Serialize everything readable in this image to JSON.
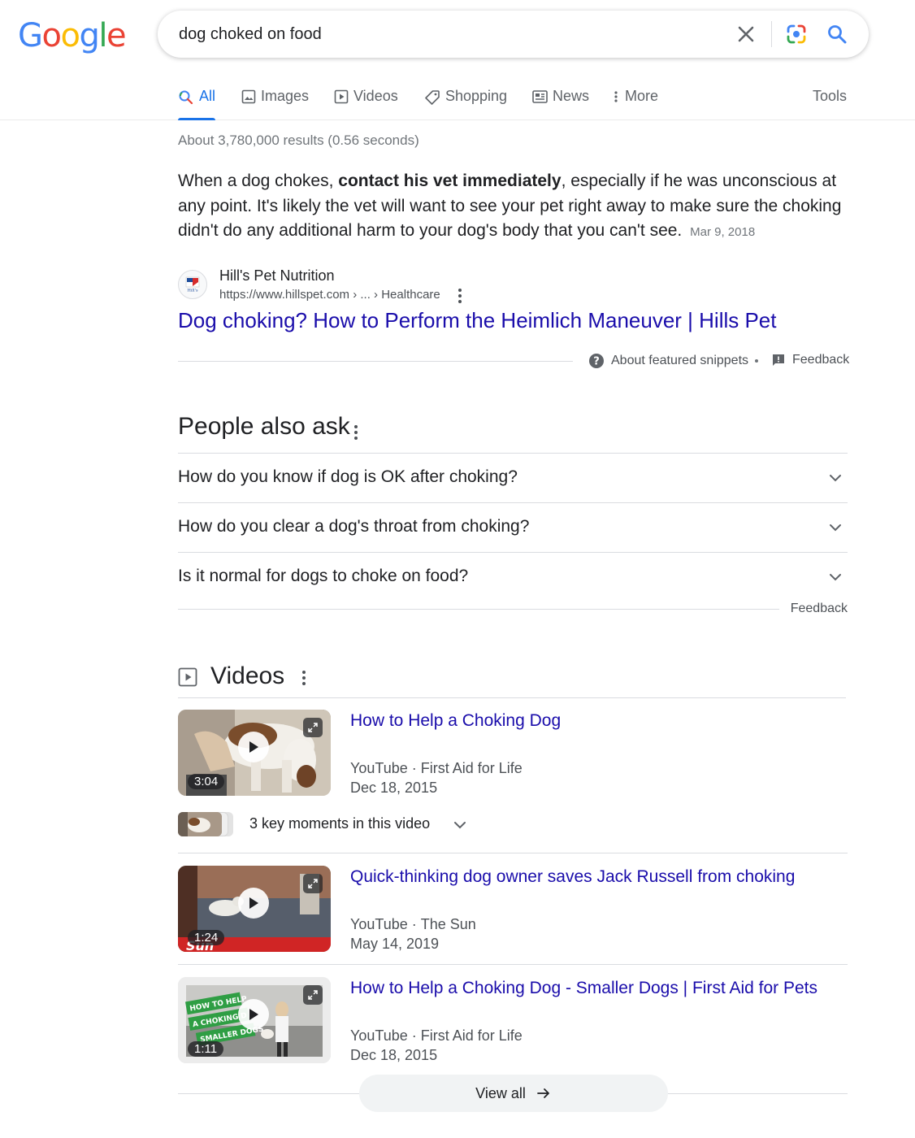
{
  "logo": {
    "letters": [
      "G",
      "o",
      "o",
      "g",
      "l",
      "e"
    ],
    "colors": [
      "#4285F4",
      "#EA4335",
      "#FBBC05",
      "#4285F4",
      "#34A853",
      "#EA4335"
    ]
  },
  "search": {
    "query": "dog choked on food"
  },
  "tabs": [
    {
      "label": "All",
      "icon": "search-icon",
      "active": true
    },
    {
      "label": "Images",
      "icon": "image-icon"
    },
    {
      "label": "Videos",
      "icon": "video-icon"
    },
    {
      "label": "Shopping",
      "icon": "tag-icon"
    },
    {
      "label": "News",
      "icon": "news-icon"
    },
    {
      "label": "More",
      "icon": "more-vert-icon"
    }
  ],
  "tools_label": "Tools",
  "result_stats": "About 3,780,000 results (0.56 seconds)",
  "snippet": {
    "text_before": "When a dog chokes, ",
    "bold": "contact his vet immediately",
    "text_after": ", especially if he was unconscious at any point. It's likely the vet will want to see your pet right away to make sure the choking didn't do any additional harm to your dog's body that you can't see.",
    "date": "Mar 9, 2018",
    "source_name": "Hill's Pet Nutrition",
    "source_url": "https://www.hillspet.com › ... › Healthcare",
    "title": "Dog choking? How to Perform the Heimlich Maneuver | Hills Pet",
    "about_label": "About featured snippets",
    "feedback_label": "Feedback",
    "favicon_text": "Hill's"
  },
  "paa": {
    "title": "People also ask",
    "questions": [
      "How do you know if dog is OK after choking?",
      "How do you clear a dog's throat from choking?",
      "Is it normal for dogs to choke on food?"
    ],
    "feedback_label": "Feedback"
  },
  "videos": {
    "title": "Videos",
    "items": [
      {
        "title": "How to Help a Choking Dog",
        "platform": "YouTube",
        "channel": "First Aid for Life",
        "date": "Dec 18, 2015",
        "duration": "3:04"
      },
      {
        "title": "Quick-thinking dog owner saves Jack Russell from choking",
        "platform": "YouTube",
        "channel": "The Sun",
        "date": "May 14, 2019",
        "duration": "1:24"
      },
      {
        "title": "How to Help a Choking Dog - Smaller Dogs | First Aid for Pets",
        "platform": "YouTube",
        "channel": "First Aid for Life",
        "date": "Dec 18, 2015",
        "duration": "1:11"
      }
    ],
    "key_moments_label": "3 key moments in this video",
    "view_all_label": "View all",
    "thumb2_watermark": "Sun",
    "thumb3_banner": [
      "HOW TO HELP",
      "A CHOKING D",
      "SMALLER DOGS"
    ]
  }
}
